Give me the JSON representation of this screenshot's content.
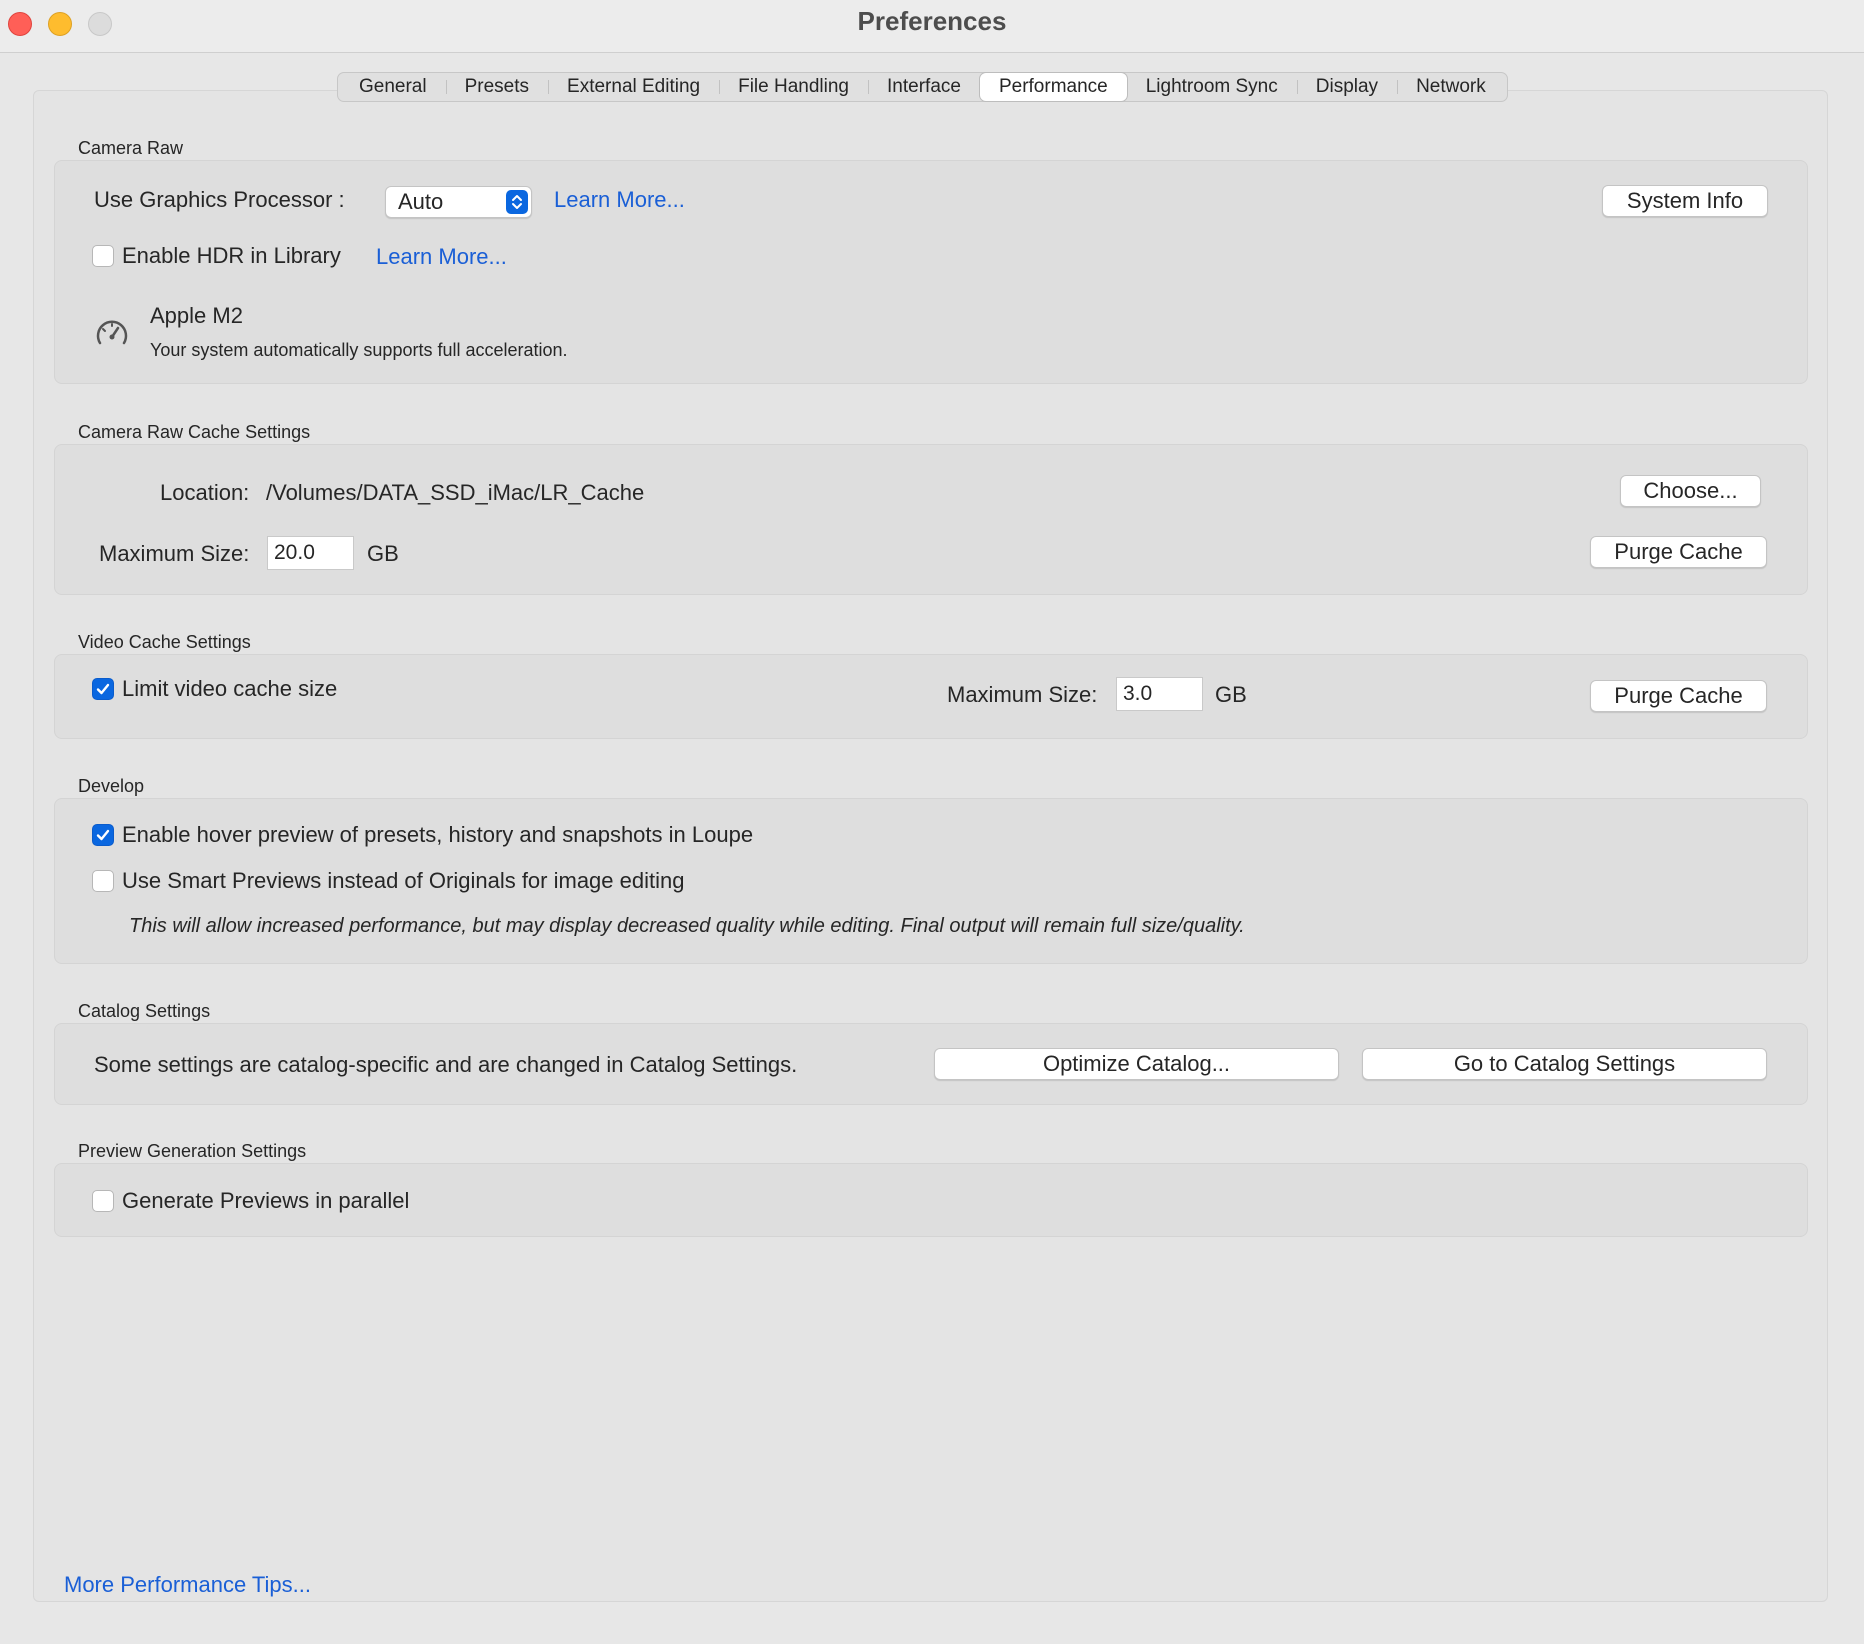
{
  "window": {
    "title": "Preferences"
  },
  "tabs": [
    "General",
    "Presets",
    "External Editing",
    "File Handling",
    "Interface",
    "Performance",
    "Lightroom Sync",
    "Display",
    "Network"
  ],
  "active_tab": "Performance",
  "camera_raw": {
    "section_label": "Camera Raw",
    "gpu_label": "Use Graphics Processor :",
    "gpu_value": "Auto",
    "learn_more_1": "Learn More...",
    "system_info_button": "System Info",
    "hdr_label": "Enable HDR in Library",
    "hdr_checked": false,
    "learn_more_2": "Learn More...",
    "gpu_name": "Apple M2",
    "gpu_status": "Your system automatically supports full acceleration."
  },
  "cache": {
    "section_label": "Camera Raw Cache Settings",
    "location_label": "Location:",
    "location_value": "/Volumes/DATA_SSD_iMac/LR_Cache",
    "choose_button": "Choose...",
    "max_size_label": "Maximum Size:",
    "max_size_value": "20.0",
    "unit": "GB",
    "purge_button": "Purge Cache"
  },
  "video_cache": {
    "section_label": "Video Cache Settings",
    "limit_label": "Limit video cache size",
    "limit_checked": true,
    "max_size_label": "Maximum Size:",
    "max_size_value": "3.0",
    "unit": "GB",
    "purge_button": "Purge Cache"
  },
  "develop": {
    "section_label": "Develop",
    "hover_label": "Enable hover preview of presets, history and snapshots in Loupe",
    "hover_checked": true,
    "smart_label": "Use Smart Previews instead of Originals for image editing",
    "smart_checked": false,
    "note": "This will allow increased performance, but may display decreased quality while editing. Final output will remain full size/quality."
  },
  "catalog": {
    "section_label": "Catalog Settings",
    "description": "Some settings are catalog-specific and are changed in Catalog Settings.",
    "optimize_button": "Optimize Catalog...",
    "goto_button": "Go to Catalog Settings"
  },
  "preview": {
    "section_label": "Preview Generation Settings",
    "parallel_label": "Generate Previews in parallel",
    "parallel_checked": false
  },
  "footer": {
    "tips_link": "More Performance Tips..."
  },
  "colors": {
    "accent": "#0a67e0",
    "link": "#1a5fd6",
    "close": "#ff5f57",
    "minimize": "#febc2e"
  }
}
